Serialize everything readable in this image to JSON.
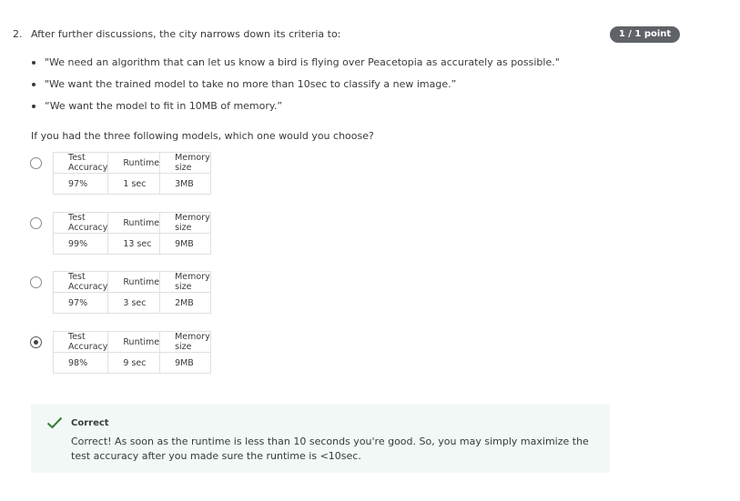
{
  "question": {
    "number": "2.",
    "text": "After further discussions, the city narrows down its criteria to:",
    "score": "1 / 1 point",
    "criteria": [
      "\"We need an algorithm that can let us know a bird is flying over Peacetopia as accurately as possible.\"",
      "\"We want the trained model to take no more than 10sec to classify a new image.”",
      "“We want the model to fit in 10MB of memory.”"
    ],
    "prompt": "If you had the three following models, which one would you choose?"
  },
  "headers": {
    "accuracy": "Test Accuracy",
    "runtime": "Runtime",
    "memory": "Memory size"
  },
  "options": [
    {
      "accuracy": "97%",
      "runtime": "1 sec",
      "memory": "3MB",
      "selected": false
    },
    {
      "accuracy": "99%",
      "runtime": "13 sec",
      "memory": "9MB",
      "selected": false
    },
    {
      "accuracy": "97%",
      "runtime": "3 sec",
      "memory": "2MB",
      "selected": false
    },
    {
      "accuracy": "98%",
      "runtime": "9 sec",
      "memory": "9MB",
      "selected": true
    }
  ],
  "feedback": {
    "title": "Correct",
    "text": "Correct! As soon as the runtime is less than 10 seconds you're good. So, you may simply maximize the test accuracy after you made sure the runtime is <10sec.",
    "color": "#2e7d32"
  }
}
